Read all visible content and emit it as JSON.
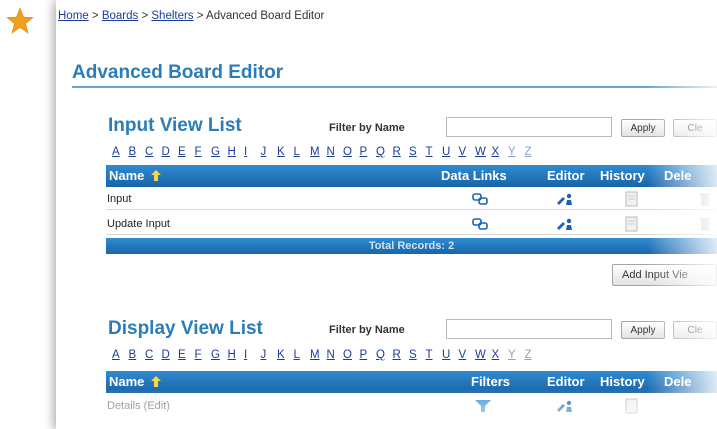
{
  "breadcrumb": {
    "home": "Home",
    "sep1": ">",
    "boards": "Boards",
    "sep2": ">",
    "shelters": "Shelters",
    "sep3": ">",
    "current": "Advanced Board Editor"
  },
  "page_title": "Advanced Board Editor",
  "input_view": {
    "title": "Input View List",
    "filter_label": "Filter by Name",
    "filter_value": "",
    "apply_label": "Apply",
    "clear_label": "Cle",
    "letters": [
      "A",
      "B",
      "C",
      "D",
      "E",
      "F",
      "G",
      "H",
      "I",
      "J",
      "K",
      "L",
      "M",
      "N",
      "O",
      "P",
      "Q",
      "R",
      "S",
      "T",
      "U",
      "V",
      "W",
      "X",
      "Y",
      "Z"
    ],
    "columns": {
      "name": "Name",
      "data_links": "Data Links",
      "editor": "Editor",
      "history": "History",
      "delete": "Dele"
    },
    "rows": [
      {
        "name": "Input"
      },
      {
        "name": "Update Input"
      }
    ],
    "footer": "Total Records: 2",
    "add_button": "Add Input Vie"
  },
  "display_view": {
    "title": "Display View List",
    "filter_label": "Filter by Name",
    "filter_value": "",
    "apply_label": "Apply",
    "clear_label": "Cle",
    "letters": [
      "A",
      "B",
      "C",
      "D",
      "E",
      "F",
      "G",
      "H",
      "I",
      "J",
      "K",
      "L",
      "M",
      "N",
      "O",
      "P",
      "Q",
      "R",
      "S",
      "T",
      "U",
      "V",
      "W",
      "X",
      "Y",
      "Z"
    ],
    "columns": {
      "name": "Name",
      "filters": "Filters",
      "editor": "Editor",
      "history": "History",
      "delete": "Dele"
    },
    "rows": [
      {
        "name": "Details (Edit)"
      }
    ]
  },
  "colors": {
    "accent": "#2a7db8",
    "header_bg": "#1f74bd",
    "link": "#1a3d9c",
    "star": "#f0a020"
  }
}
